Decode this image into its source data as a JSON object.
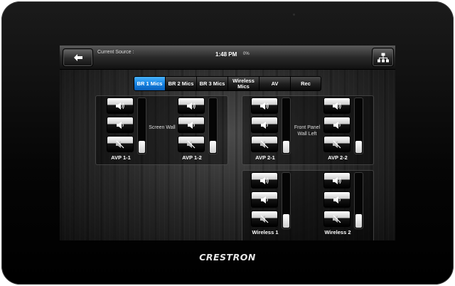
{
  "brand": "CRESTRON",
  "header": {
    "current_source_label": "Current Source :",
    "time": "1:48 PM",
    "battery": "0%"
  },
  "tabs": [
    {
      "label": "BR 1 Mics",
      "active": true
    },
    {
      "label": "BR 2 Mics",
      "active": false
    },
    {
      "label": "BR 3 Mics",
      "active": false
    },
    {
      "label": "Wireless Mics",
      "active": false
    },
    {
      "label": "AV",
      "active": false
    },
    {
      "label": "Rec",
      "active": false
    }
  ],
  "rooms": {
    "screen_wall": "Screen Wall",
    "front_panel": "Front Panel Wall Left"
  },
  "channels": [
    {
      "label": "AVP 1-1",
      "level": 0.22
    },
    {
      "label": "AVP 1-2",
      "level": 0.22
    },
    {
      "label": "AVP 2-1",
      "level": 0.22
    },
    {
      "label": "AVP 2-2",
      "level": 0.22
    },
    {
      "label": "Wireless 1",
      "level": 0.25
    },
    {
      "label": "Wireless 2",
      "level": 0.25
    }
  ],
  "icons": {
    "back": "back-arrow-icon",
    "network": "network-tree-icon",
    "volume_up": "speaker-loud-icon",
    "volume_down": "speaker-quiet-icon",
    "mute": "speaker-mute-icon"
  },
  "colors": {
    "active_tab": "#1e8cf0"
  }
}
